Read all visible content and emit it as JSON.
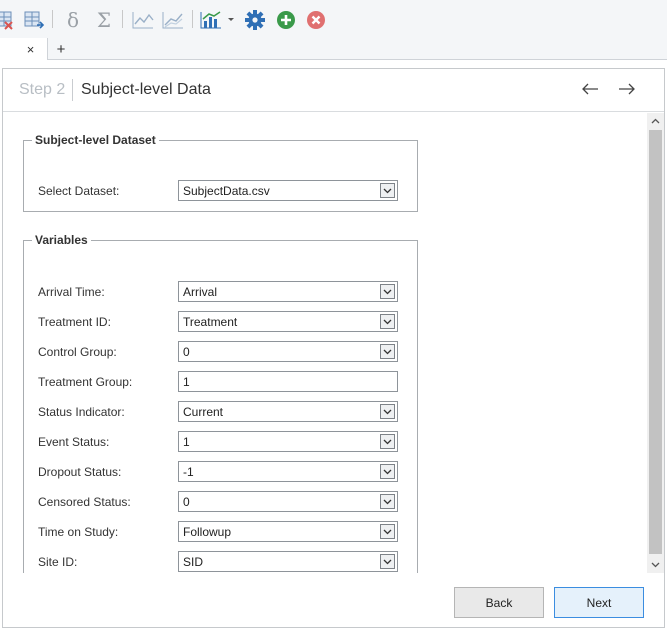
{
  "tabs": {
    "close_glyph": "×",
    "add_glyph": "+"
  },
  "header": {
    "step_label": "Step 2",
    "title": "Subject-level Data",
    "back_arrow": "←",
    "forward_arrow": "→"
  },
  "dataset_group": {
    "legend": "Subject-level Dataset",
    "select_label": "Select Dataset:",
    "selected_value": "SubjectData.csv"
  },
  "variables_group": {
    "legend": "Variables",
    "rows": [
      {
        "label": "Arrival Time:",
        "value": "Arrival",
        "type": "combo"
      },
      {
        "label": "Treatment ID:",
        "value": "Treatment",
        "type": "combo"
      },
      {
        "label": "Control Group:",
        "value": "0",
        "type": "combo"
      },
      {
        "label": "Treatment Group:",
        "value": "1",
        "type": "text"
      },
      {
        "label": "Status Indicator:",
        "value": "Current",
        "type": "combo"
      },
      {
        "label": "Event Status:",
        "value": "1",
        "type": "combo"
      },
      {
        "label": "Dropout Status:",
        "value": "-1",
        "type": "combo"
      },
      {
        "label": "Censored Status:",
        "value": "0",
        "type": "combo"
      },
      {
        "label": "Time on Study:",
        "value": "Followup",
        "type": "combo"
      },
      {
        "label": "Site ID:",
        "value": "SID",
        "type": "combo"
      }
    ]
  },
  "footer": {
    "back_label": "Back",
    "next_label": "Next"
  },
  "icons": {
    "toolbar": [
      "delete-table-icon",
      "table-import-icon",
      "delta-icon",
      "sigma-icon",
      "line-chart-icon",
      "area-chart-icon",
      "bar-chart-dropdown-icon",
      "gear-icon",
      "add-circle-icon",
      "remove-circle-icon"
    ]
  },
  "colors": {
    "accent_blue": "#2f6fb5",
    "add_green": "#3a9a4a",
    "remove_red": "#e07070",
    "next_border": "#3b8de0"
  }
}
